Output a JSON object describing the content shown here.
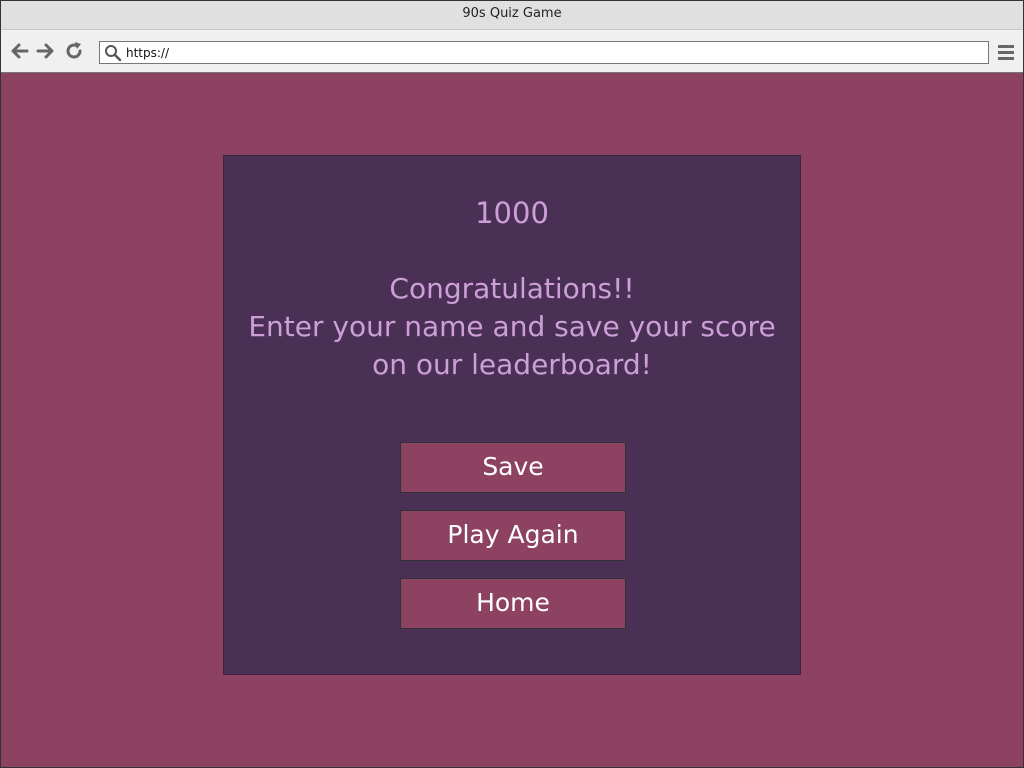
{
  "window": {
    "title": "90s Quiz Game"
  },
  "toolbar": {
    "url": "https://",
    "icons": [
      "back-arrow-icon",
      "forward-arrow-icon",
      "reload-icon",
      "search-icon",
      "hamburger-menu-icon"
    ]
  },
  "end_screen": {
    "score": "1000",
    "message_lines": [
      "Congratulations!!",
      "Enter your name and save your score",
      "on our leaderboard!"
    ],
    "buttons": {
      "save": "Save",
      "play_again": "Play Again",
      "home": "Home"
    }
  },
  "colors": {
    "page_background": "#8e4262",
    "panel_background": "#4b3055",
    "text_accent": "#cc9fd9",
    "button_background": "#8e4262",
    "button_text": "#ffffff"
  }
}
